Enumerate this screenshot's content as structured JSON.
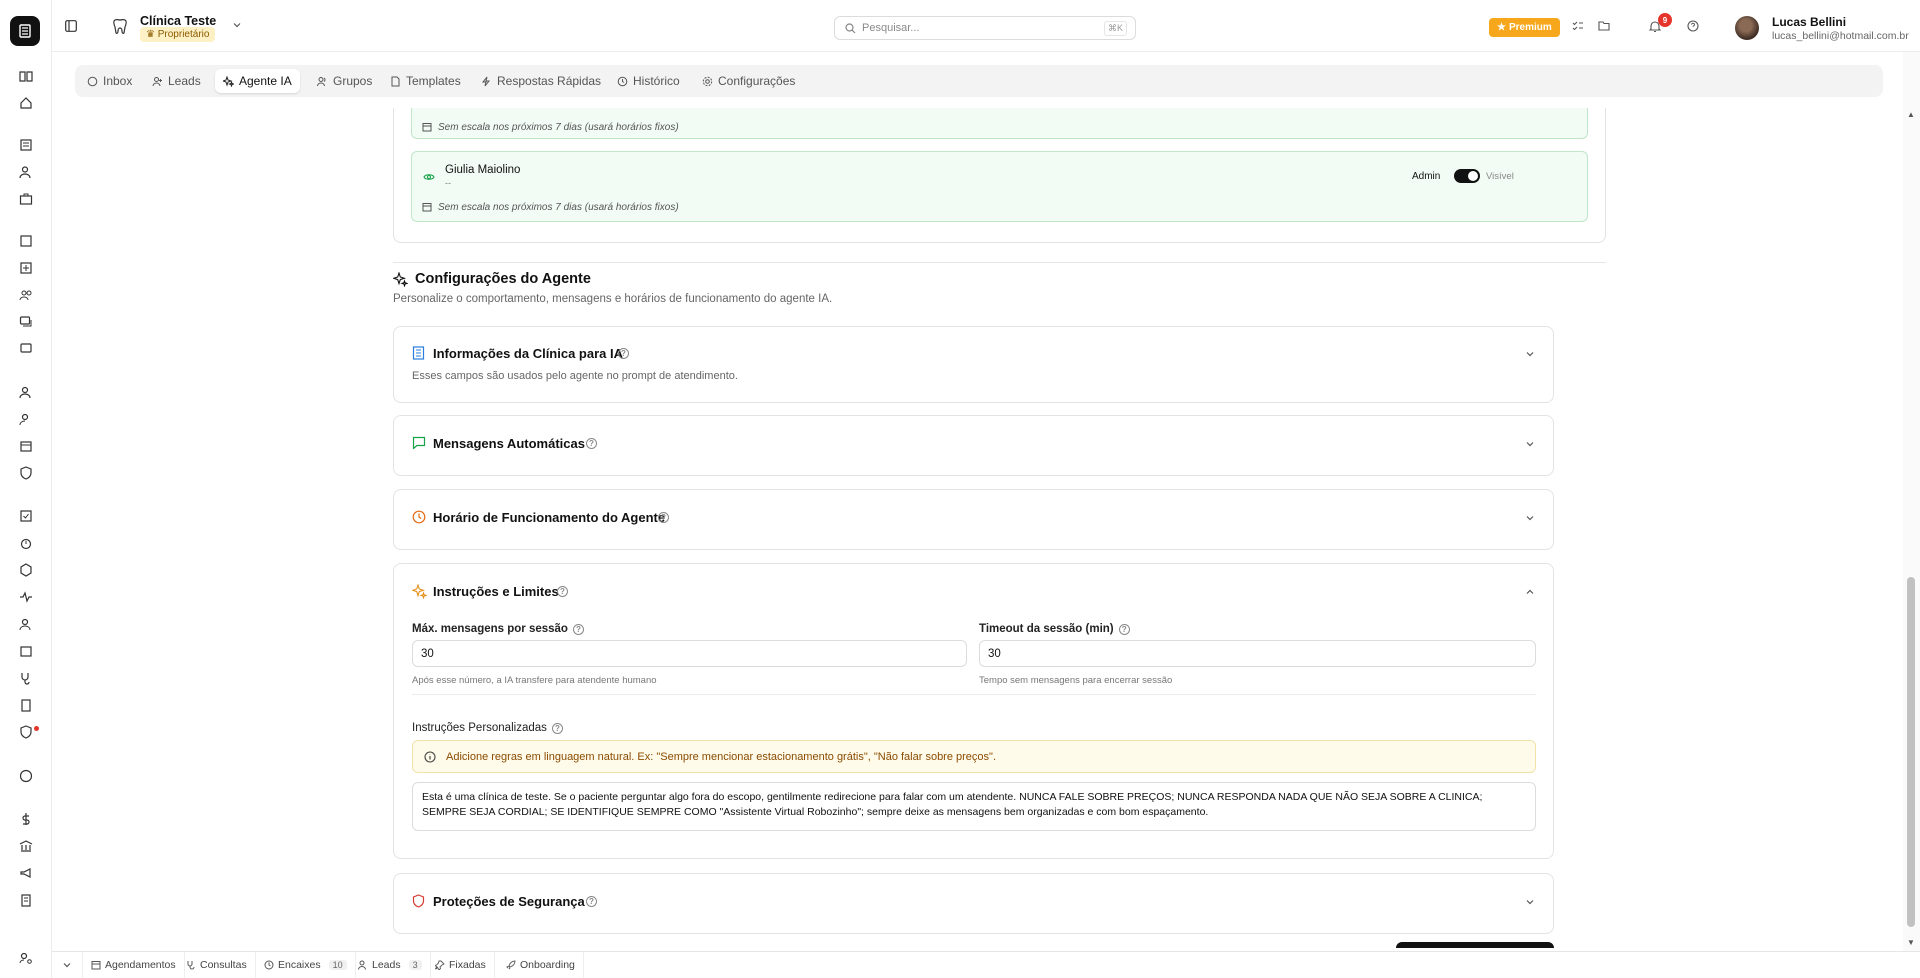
{
  "header": {
    "clinic_name": "Clínica Teste",
    "clinic_role": "Proprietário",
    "search_placeholder": "Pesquisar...",
    "search_shortcut": "⌘K",
    "premium_label": "Premium",
    "notifications_count": "9",
    "user_name": "Lucas Bellini",
    "user_email": "lucas_bellini@hotmail.com.br"
  },
  "tabs": [
    {
      "label": "Inbox",
      "icon": "whatsapp-icon"
    },
    {
      "label": "Leads",
      "icon": "user-plus-icon"
    },
    {
      "label": "Agente IA",
      "icon": "sparkles-icon",
      "active": true
    },
    {
      "label": "Grupos",
      "icon": "users-icon"
    },
    {
      "label": "Templates",
      "icon": "file-icon"
    },
    {
      "label": "Respostas Rápidas",
      "icon": "zap-icon"
    },
    {
      "label": "Histórico",
      "icon": "history-icon"
    },
    {
      "label": "Configurações",
      "icon": "gear-icon"
    }
  ],
  "attendants": {
    "first_note": "Sem escala nos próximos 7 dias (usará horários fixos)",
    "second": {
      "name": "Giulia Maiolino",
      "sub": "--",
      "role": "Admin",
      "visibility": "Visível",
      "visible": true,
      "note": "Sem escala nos próximos 7 dias (usará horários fixos)"
    }
  },
  "agent_settings": {
    "title": "Configurações do Agente",
    "subtitle": "Personalize o comportamento, mensagens e horários de funcionamento do agente IA."
  },
  "sections": {
    "clinic_info": {
      "title": "Informações da Clínica para IA",
      "desc": "Esses campos são usados pelo agente no prompt de atendimento."
    },
    "auto_messages": {
      "title": "Mensagens Automáticas"
    },
    "schedule": {
      "title": "Horário de Funcionamento do Agente"
    },
    "instructions": {
      "title": "Instruções e Limites",
      "max_label": "Máx. mensagens por sessão",
      "max_value": "30",
      "max_hint": "Após esse número, a IA transfere para atendente humano",
      "timeout_label": "Timeout da sessão (min)",
      "timeout_value": "30",
      "timeout_hint": "Tempo sem mensagens para encerrar sessão",
      "custom_label": "Instruções Personalizadas",
      "alert": "Adicione regras em linguagem natural. Ex: \"Sempre mencionar estacionamento grátis\", \"Não falar sobre preços\".",
      "custom_text": "Esta é uma clínica de teste. Se o paciente perguntar algo fora do escopo, gentilmente redirecione para falar com um atendente. NUNCA FALE SOBRE PREÇOS; NUNCA RESPONDA NADA QUE NÃO SEJA SOBRE A CLINICA;  SEMPRE SEJA CORDIAL; SE IDENTIFIQUE SEMPRE COMO \"Assistente Virtual Robozinho\"; sempre deixe as mensagens bem organizadas e com bom espaçamento."
    },
    "security": {
      "title": "Proteções de Segurança"
    }
  },
  "footer": {
    "items": [
      {
        "label": "Agendamentos"
      },
      {
        "label": "Consultas"
      },
      {
        "label": "Encaixes",
        "count": "10"
      },
      {
        "label": "Leads",
        "count": "3"
      },
      {
        "label": "Fixadas"
      },
      {
        "label": "Onboarding"
      }
    ]
  },
  "colors": {
    "accent_green": "#16a34a",
    "premium": "#f6a71c",
    "badge_red": "#e5342b",
    "warning_bg": "#fffbea"
  }
}
